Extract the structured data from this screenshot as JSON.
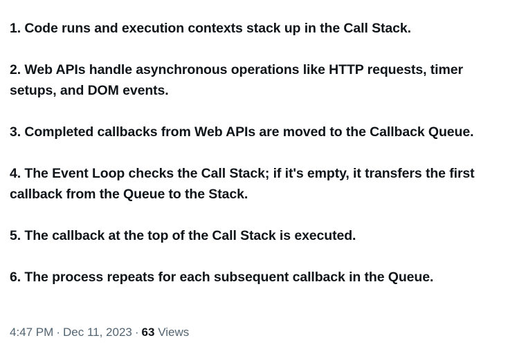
{
  "tweet": {
    "steps": [
      "1. Code runs and execution contexts stack up in the Call Stack.",
      "2. Web APIs handle asynchronous operations like HTTP requests, timer setups, and DOM events.",
      "3. Completed callbacks from Web APIs are moved to the Callback Queue.",
      "4. The Event Loop checks the Call Stack; if it's empty, it transfers the first callback from the Queue to the Stack.",
      "5. The callback at the top of the Call Stack is executed.",
      "6. The process repeats for each subsequent callback in the Queue."
    ],
    "meta": {
      "time": "4:47 PM",
      "separator": "·",
      "date": "Dec 11, 2023",
      "views_count": "63",
      "views_label": "Views"
    }
  }
}
